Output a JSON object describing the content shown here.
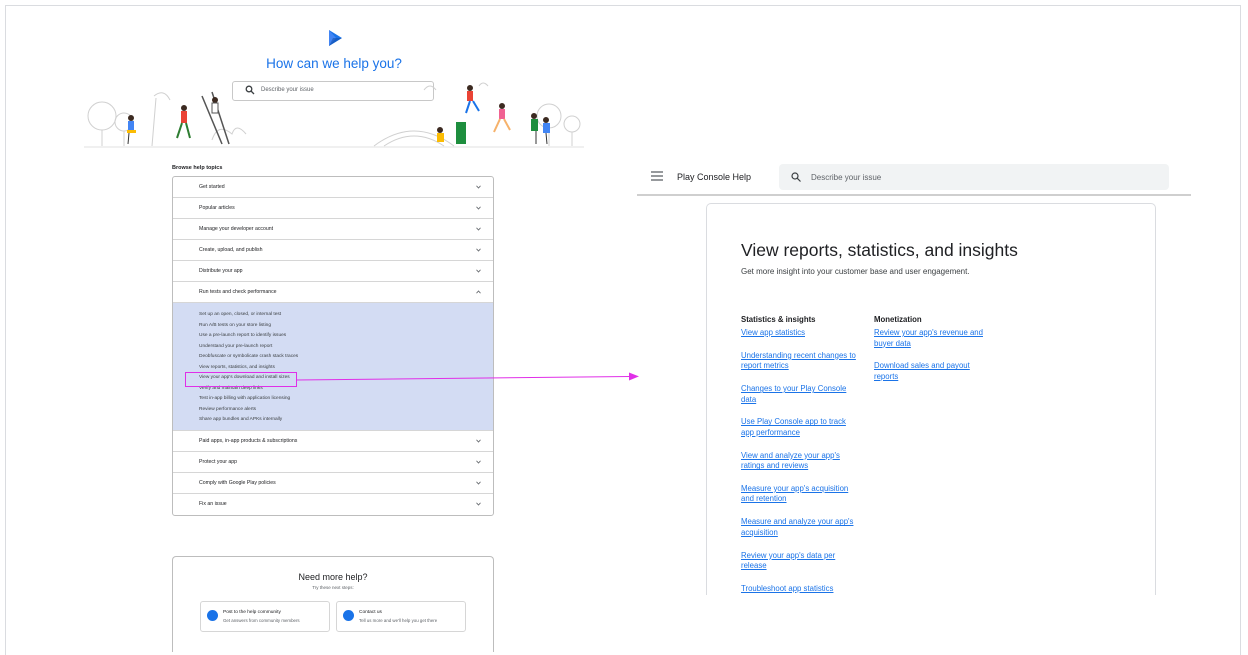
{
  "hero": {
    "title": "How can we help you?",
    "search_placeholder": "Describe your issue"
  },
  "browse": {
    "title": "Browse help topics",
    "topics_before": [
      "Get started",
      "Popular articles",
      "Manage your developer account",
      "Create, upload, and publish",
      "Distribute your app"
    ],
    "expanded_topic": "Run tests and check performance",
    "sub_items": [
      "Set up an open, closed, or internal test",
      "Run A/B tests on your store listing",
      "Use a pre-launch report to identify issues",
      "Understand your pre-launch report",
      "Deobfuscate or symbolicate crash stack traces",
      "View reports, statistics, and insights",
      "View your app's download and install sizes",
      "Verify and maintain deep links",
      "Test in-app billing with application licensing",
      "Review performance alerts",
      "Share app bundles and APKs internally"
    ],
    "topics_after": [
      "Paid apps, in-app products & subscriptions",
      "Protect your app",
      "Comply with Google Play policies",
      "Fix an issue"
    ]
  },
  "help": {
    "title": "Need more help?",
    "subtitle": "Try these next steps:",
    "options": [
      {
        "title": "Post to the help community",
        "desc": "Get answers from community members"
      },
      {
        "title": "Contact us",
        "desc": "Tell us more and we'll help you get there"
      }
    ]
  },
  "right_header": {
    "title": "Play Console Help",
    "search_placeholder": "Describe your issue"
  },
  "article": {
    "title": "View reports, statistics, and insights",
    "subtitle": "Get more insight into your customer base and user engagement.",
    "col1_heading": "Statistics & insights",
    "col1_links": [
      "View app statistics",
      "Understanding recent changes to report metrics",
      "Changes to your Play Console data",
      "Use Play Console app to track app performance",
      "View and analyze your app's ratings and reviews",
      "Measure your app's acquisition and retention",
      "Measure and analyze your app's acquisition",
      "Review your app's data per release",
      "Troubleshoot app statistics"
    ],
    "col2_heading": "Monetization",
    "col2_links": [
      "Review your app's revenue and buyer data",
      "Download sales and payout reports"
    ]
  },
  "colors": {
    "accent": "#1a73e8",
    "highlight_box": "#e02fe8",
    "expanded_bg": "#d3dcf3"
  },
  "icons": [
    "play-console-logo-icon",
    "search-icon",
    "chevron-down-icon",
    "chevron-up-icon",
    "menu-icon",
    "community-icon",
    "contact-icon",
    "annotation-arrow"
  ]
}
